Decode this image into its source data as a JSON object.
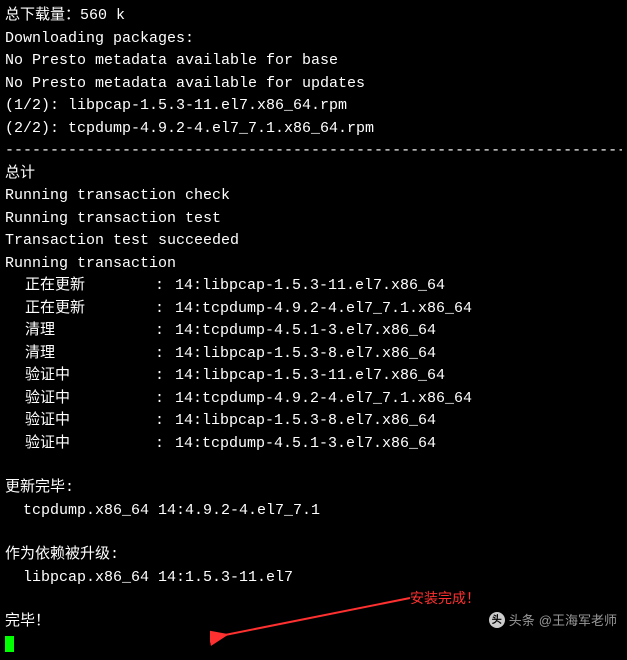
{
  "header": {
    "download_total": "总下载量：560 k",
    "downloading": "Downloading packages:",
    "presto1": "No Presto metadata available for base",
    "presto2": "No Presto metadata available for updates",
    "pkg1": "(1/2): libpcap-1.5.3-11.el7.x86_64.rpm",
    "pkg2": "(2/2): tcpdump-4.9.2-4.el7_7.1.x86_64.rpm"
  },
  "divider": "---------------------------------------------------------------------",
  "summary": {
    "total": "总计",
    "check": "Running transaction check",
    "test": "Running transaction test",
    "succeeded": "Transaction test succeeded",
    "running": "Running transaction"
  },
  "transactions": [
    {
      "action": "正在更新",
      "sep": ":",
      "pkg": "14:libpcap-1.5.3-11.el7.x86_64"
    },
    {
      "action": "正在更新",
      "sep": ":",
      "pkg": "14:tcpdump-4.9.2-4.el7_7.1.x86_64"
    },
    {
      "action": "清理",
      "sep": ":",
      "pkg": "14:tcpdump-4.5.1-3.el7.x86_64"
    },
    {
      "action": "清理",
      "sep": ":",
      "pkg": "14:libpcap-1.5.3-8.el7.x86_64"
    },
    {
      "action": "验证中",
      "sep": ":",
      "pkg": "14:libpcap-1.5.3-11.el7.x86_64"
    },
    {
      "action": "验证中",
      "sep": ":",
      "pkg": "14:tcpdump-4.9.2-4.el7_7.1.x86_64"
    },
    {
      "action": "验证中",
      "sep": ":",
      "pkg": "14:libpcap-1.5.3-8.el7.x86_64"
    },
    {
      "action": "验证中",
      "sep": ":",
      "pkg": "14:tcpdump-4.5.1-3.el7.x86_64"
    }
  ],
  "updated": {
    "title": "更新完毕:",
    "pkg": "  tcpdump.x86_64 14:4.9.2-4.el7_7.1"
  },
  "dependency": {
    "title": "作为依赖被升级:",
    "pkg": "  libpcap.x86_64 14:1.5.3-11.el7"
  },
  "complete": "完毕！",
  "annotation": "安装完成！",
  "watermark": "@王海军老师",
  "watermark_brand": "头条"
}
